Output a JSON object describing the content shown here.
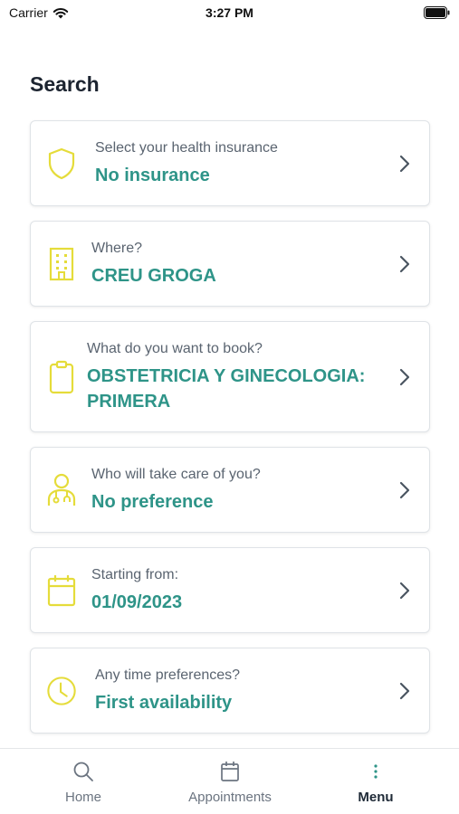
{
  "status_bar": {
    "carrier": "Carrier",
    "time": "3:27 PM"
  },
  "page": {
    "title": "Search"
  },
  "cards": [
    {
      "label": "Select your health insurance",
      "value": "No insurance",
      "icon": "shield-icon"
    },
    {
      "label": "Where?",
      "value": "CREU GROGA",
      "icon": "building-icon"
    },
    {
      "label": "What do you want to book?",
      "value": "OBSTETRICIA Y GINECOLOGIA: PRIMERA",
      "icon": "clipboard-icon"
    },
    {
      "label": "Who will take care of you?",
      "value": "No preference",
      "icon": "doctor-icon"
    },
    {
      "label": "Starting from:",
      "value": "01/09/2023",
      "icon": "calendar-icon"
    },
    {
      "label": "Any time preferences?",
      "value": "First availability",
      "icon": "clock-icon"
    }
  ],
  "tabbar": {
    "tabs": [
      {
        "label": "Home",
        "icon": "search-icon",
        "active": false
      },
      {
        "label": "Appointments",
        "icon": "calendar-icon",
        "active": false
      },
      {
        "label": "Menu",
        "icon": "more-vertical-icon",
        "active": true
      }
    ]
  },
  "colors": {
    "accent": "#2e9488",
    "icon_yellow": "#e5dc3a",
    "label_gray": "#5a6470"
  }
}
